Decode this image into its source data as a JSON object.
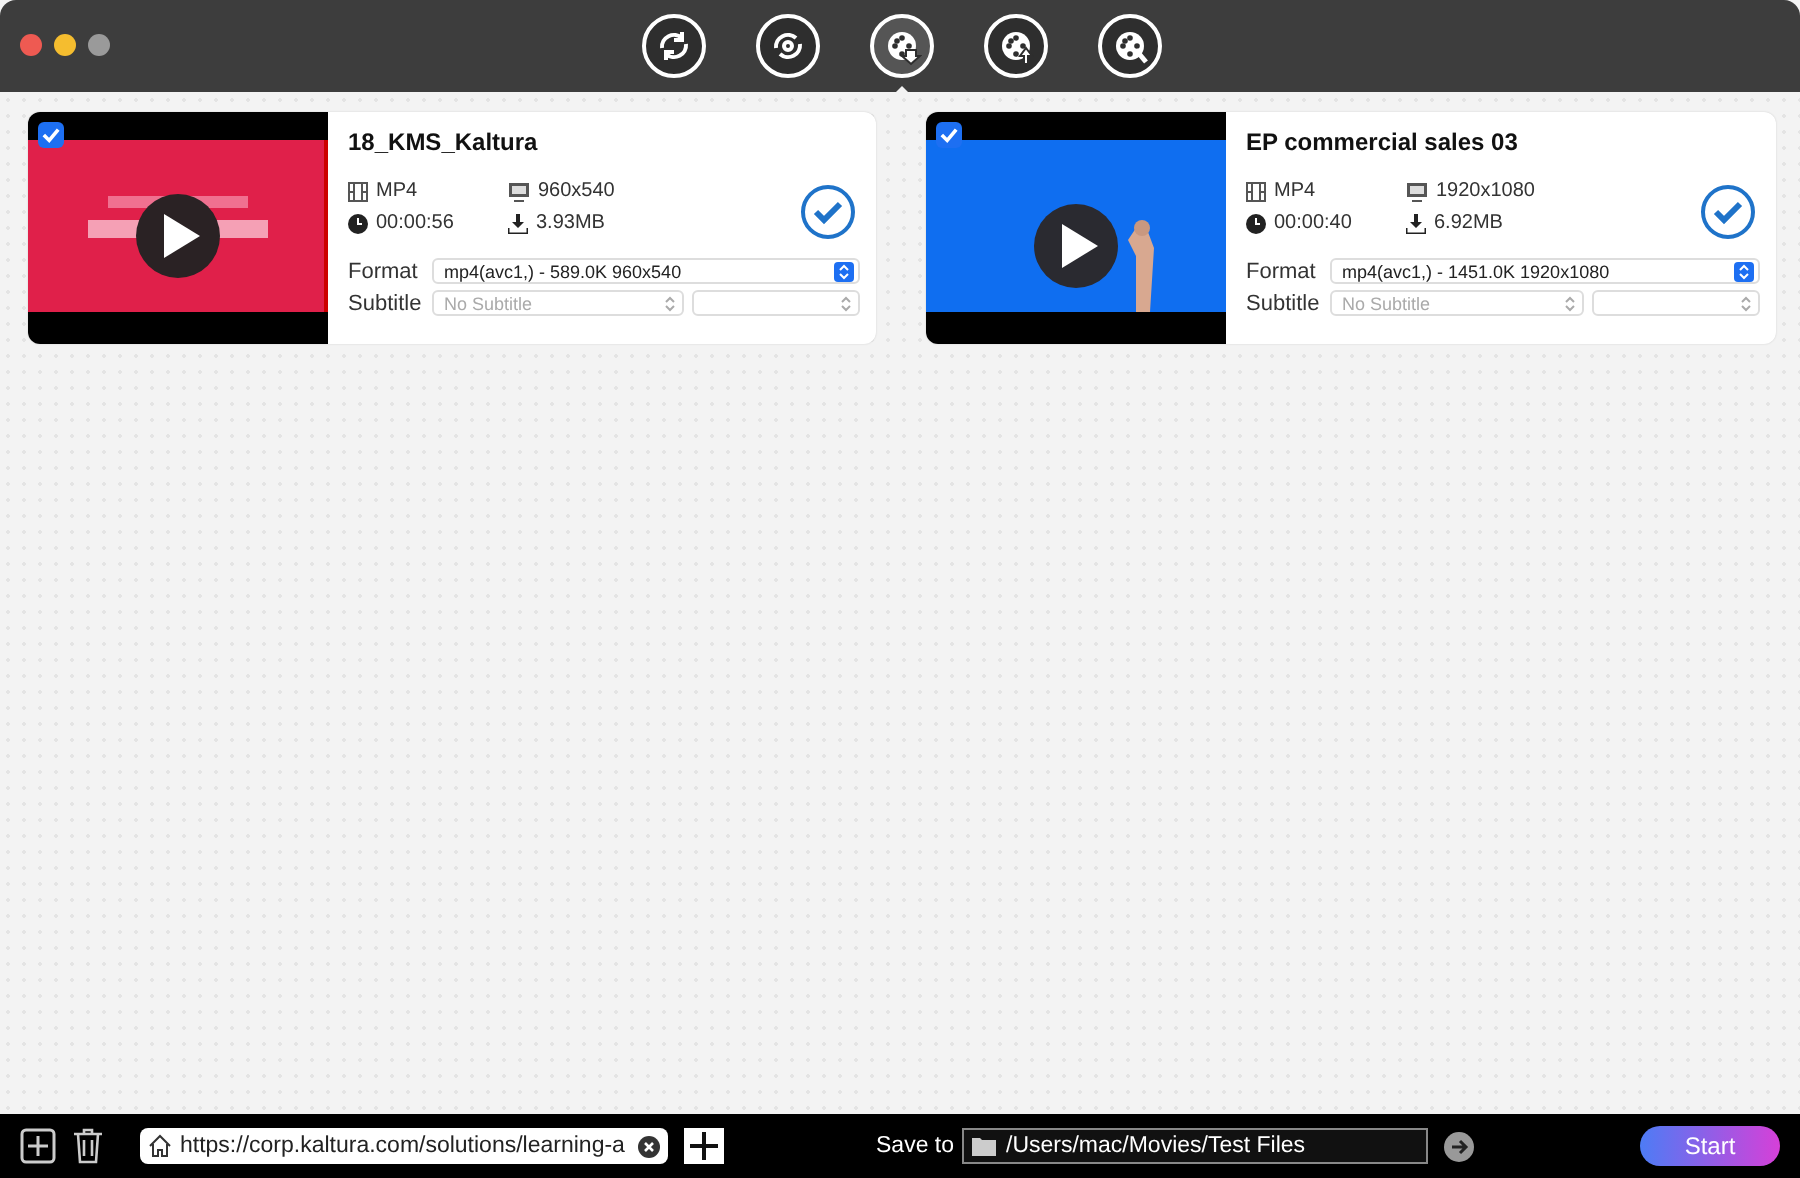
{
  "toolbar": [
    {
      "kind": "convert",
      "selected": false
    },
    {
      "kind": "record",
      "selected": false
    },
    {
      "kind": "download",
      "selected": true
    },
    {
      "kind": "upload",
      "selected": false
    },
    {
      "kind": "edit",
      "selected": false
    }
  ],
  "videos": [
    {
      "title": "18_KMS_Kaltura",
      "checked": true,
      "thumbnail": {
        "kind": "title"
      },
      "format": "MP4",
      "resolution": "960x540",
      "duration": "00:00:56",
      "size": "3.93MB",
      "done": true,
      "format_label": "Format",
      "format_value": "mp4(avc1,) - 589.0K 960x540",
      "subtitle_label": "Subtitle",
      "subtitle_placeholder": "No Subtitle"
    },
    {
      "title": "EP commercial sales 03",
      "checked": true,
      "thumbnail": {
        "kind": "gesture"
      },
      "format": "MP4",
      "resolution": "1920x1080",
      "duration": "00:00:40",
      "size": "6.92MB",
      "done": true,
      "format_label": "Format",
      "format_value": "mp4(avc1,) - 1451.0K 1920x1080",
      "subtitle_label": "Subtitle",
      "subtitle_placeholder": "No Subtitle"
    }
  ],
  "bottom_bar": {
    "url": "https://corp.kaltura.com/solutions/learning-a",
    "save_to_label": "Save to",
    "save_path": "/Users/mac/Movies/Test Files",
    "start_button": "Start"
  }
}
